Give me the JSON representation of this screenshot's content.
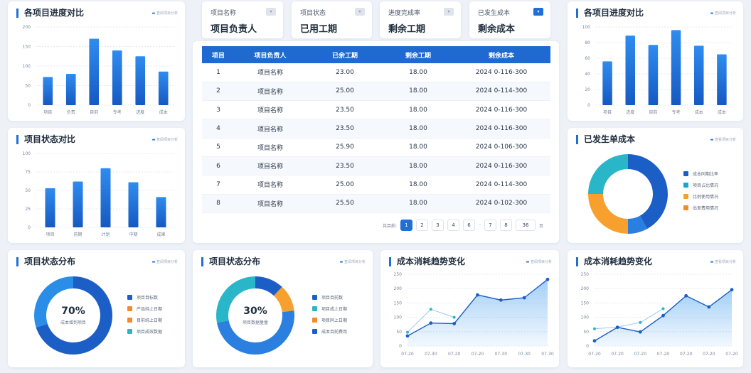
{
  "filters": [
    {
      "label": "项目名称",
      "value": "项目负责人",
      "active": false
    },
    {
      "label": "项目状态",
      "value": "已用工期",
      "active": false
    },
    {
      "label": "进度完成率",
      "value": "剩余工期",
      "active": false
    },
    {
      "label": "已发生成本",
      "value": "剩余成本",
      "active": true
    }
  ],
  "table": {
    "headers": [
      "项目",
      "项目负责人",
      "已余工期",
      "剩余工期",
      "剩余成本"
    ],
    "rows": [
      [
        "1",
        "项目名称",
        "23.00",
        "18.00",
        "2024 0-116-300"
      ],
      [
        "2",
        "项目名称",
        "25.00",
        "18.00",
        "2024 0-114-300"
      ],
      [
        "3",
        "项目名称",
        "23.50",
        "18.00",
        "2024 0-116-300"
      ],
      [
        "4",
        "项目名称",
        "23.50",
        "18.00",
        "2024 0-116-300"
      ],
      [
        "5",
        "项目名称",
        "25.90",
        "18.00",
        "2024 0-106-300"
      ],
      [
        "6",
        "项目名称",
        "23.50",
        "18.00",
        "2024 0-116-300"
      ],
      [
        "7",
        "项目名称",
        "25.00",
        "18.00",
        "2024 0-114-300"
      ],
      [
        "8",
        "项目名称",
        "25.50",
        "18.00",
        "2024 0-102-300"
      ]
    ]
  },
  "pager": {
    "prefix": "共目前:",
    "pages": [
      "1",
      "2",
      "3",
      "4",
      "6"
    ],
    "dots": "·",
    "more_pages": [
      "7",
      "8"
    ],
    "size": "36",
    "suffix": "页",
    "active_index": 0
  },
  "charts": {
    "bar_tl": {
      "title": "各项目进度对比",
      "link": "查阅项目分析",
      "chart_data": {
        "type": "bar",
        "categories": [
          "项目",
          "负责",
          "目前",
          "专考",
          "进度",
          "成本"
        ],
        "values": [
          72,
          80,
          170,
          140,
          125,
          86
        ],
        "yticks": [
          0,
          50,
          100,
          150,
          200
        ],
        "ylim": [
          0,
          200
        ]
      }
    },
    "bar_ml": {
      "title": "项目状态对比",
      "link": "查阅项目分析",
      "chart_data": {
        "type": "bar",
        "categories": [
          "项目",
          "前期",
          "计划",
          "中期",
          "成果"
        ],
        "values": [
          53,
          62,
          80,
          61,
          41
        ],
        "yticks": [
          0,
          25,
          50,
          75,
          100
        ],
        "ylim": [
          0,
          100
        ]
      }
    },
    "bar_tr": {
      "title": "各项目进度对比",
      "link": "查阅项目分析",
      "chart_data": {
        "type": "bar",
        "categories": [
          "项目",
          "进度",
          "目前",
          "专考",
          "成本",
          "成本"
        ],
        "values": [
          56,
          89,
          77,
          96,
          76,
          65
        ],
        "yticks": [
          0,
          20,
          40,
          60,
          80,
          100
        ],
        "ylim": [
          0,
          100
        ]
      }
    },
    "donut_r": {
      "title": "已发生单成本",
      "link": "查看项目分析",
      "chart_data": {
        "type": "pie",
        "categories": [
          "成本同期比率",
          "项目占比情况",
          "比例使用情况",
          "出差费用情况"
        ],
        "values": [
          42,
          8,
          25,
          25
        ],
        "colors": [
          "#1b5fc6",
          "#2a7fe0",
          "#f7a02d",
          "#2ab6c9"
        ]
      },
      "legend_colors": [
        "#1b5fc6",
        "#1aa3d6",
        "#f7a02d",
        "#f58a2a"
      ]
    },
    "donut_bl": {
      "title": "项目状态分布",
      "link": "查阅项目分析",
      "center_value": "70%",
      "center_label": "成本增到项目",
      "chart_data": {
        "type": "pie",
        "categories": [
          "项目目标数",
          "产品纯上日期",
          "目前纯上日期",
          "项目成效数据"
        ],
        "values": [
          70,
          30
        ],
        "colors": [
          "#1b5fc6",
          "#2a8ee8"
        ]
      },
      "legend_colors": [
        "#1b5fc6",
        "#f58a2a",
        "#f58a2a",
        "#2ab6c9"
      ]
    },
    "donut_bm": {
      "title": "项目状态分布",
      "link": "查阅项目分析",
      "center_value": "30%",
      "center_label": "项目数据量量",
      "chart_data": {
        "type": "pie",
        "categories": [
          "项目目前数",
          "项目成上日期",
          "项目同上日期",
          "成本目前费用"
        ],
        "values": [
          12,
          11,
          49,
          28
        ],
        "colors": [
          "#1b5fc6",
          "#f7a02d",
          "#2a7fe0",
          "#2ab6c9"
        ]
      },
      "legend_colors": [
        "#1b5fc6",
        "#2ab6c9",
        "#f58a2a",
        "#1b5fc6"
      ]
    },
    "area_bm": {
      "title": "成本消耗趋势变化",
      "link": "查阅项目分析",
      "chart_data": {
        "type": "area",
        "x": [
          "07-20",
          "07-30",
          "07-20",
          "07-20",
          "07-30",
          "07-30",
          "07-30"
        ],
        "series": [
          {
            "values": [
              35,
              80,
              78,
              178,
              160,
              168,
              232
            ]
          },
          {
            "values": [
              48,
              128,
              100,
              0,
              0,
              0,
              0
            ]
          }
        ],
        "yticks": [
          0,
          50,
          100,
          150,
          200,
          250
        ],
        "ylim": [
          0,
          250
        ]
      }
    },
    "area_br": {
      "title": "成本消耗趋势变化",
      "link": "查看项目分析",
      "chart_data": {
        "type": "area",
        "x": [
          "07-20",
          "07-20",
          "07-20",
          "07-20",
          "07-20",
          "07-20",
          "07-20"
        ],
        "series": [
          {
            "values": [
              18,
              65,
              49,
              106,
              175,
              136,
              196
            ]
          },
          {
            "values": [
              60,
              66,
              82,
              130,
              0,
              0,
              0
            ]
          }
        ],
        "yticks": [
          0,
          50,
          100,
          150,
          200,
          250
        ],
        "ylim": [
          0,
          250
        ]
      }
    }
  }
}
